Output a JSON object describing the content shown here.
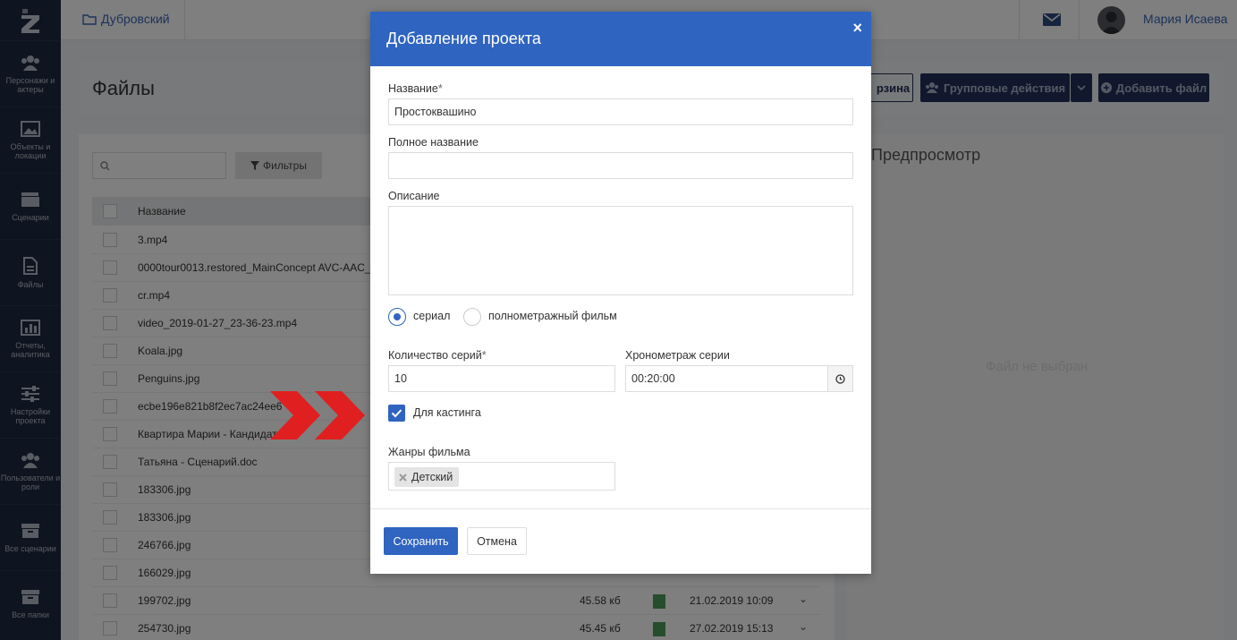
{
  "topbar": {
    "breadcrumb": "Дубровский",
    "user_name": "Мария Исаева"
  },
  "sidebar": {
    "items": [
      {
        "label": "Персонажи и актеры"
      },
      {
        "label": "Объекты и локации"
      },
      {
        "label": "Сценарии"
      },
      {
        "label": "Файлы"
      },
      {
        "label": "Отчеты, аналитика"
      },
      {
        "label": "Настройки проекта"
      },
      {
        "label": "Пользователи и роли"
      },
      {
        "label": "Все сценарии"
      },
      {
        "label": "Все папки"
      }
    ]
  },
  "page": {
    "title": "Файлы",
    "trash_label": "Корзина",
    "trash_visible": "рзина",
    "group_actions_label": "Групповые действия",
    "add_file_label": "Добавить файл",
    "filters_label": "Фильтры",
    "column_name": "Название",
    "preview_title": "Предпросмотр",
    "no_file_label": "Файл не выбран"
  },
  "files": [
    {
      "name": "3.mp4",
      "size": "",
      "date": ""
    },
    {
      "name": "0000tour0013.restored_MainConcept AVC-AAC_",
      "size": "",
      "date": ""
    },
    {
      "name": "cr.mp4",
      "size": "",
      "date": ""
    },
    {
      "name": "video_2019-01-27_23-36-23.mp4",
      "size": "",
      "date": ""
    },
    {
      "name": "Koala.jpg",
      "size": "",
      "date": ""
    },
    {
      "name": "Penguins.jpg",
      "size": "",
      "date": ""
    },
    {
      "name": "ecbe196e821b8f2ec7ac24ee6",
      "size": "",
      "date": ""
    },
    {
      "name": "Квартира Марии - Кандидат",
      "size": "",
      "date": ""
    },
    {
      "name": "Татьяна - Сценарий.doc",
      "size": "",
      "date": ""
    },
    {
      "name": "183306.jpg",
      "size": "",
      "date": ""
    },
    {
      "name": "183306.jpg",
      "size": "",
      "date": ""
    },
    {
      "name": "246766.jpg",
      "size": "",
      "date": ""
    },
    {
      "name": "166029.jpg",
      "size": "",
      "date": ""
    },
    {
      "name": "199702.jpg",
      "size": "45.58 кб",
      "date": "21.02.2019 10:09"
    },
    {
      "name": "254730.jpg",
      "size": "45.45 кб",
      "date": "27.02.2019 15:13"
    }
  ],
  "modal": {
    "title": "Добавление проекта",
    "close_glyph": "×",
    "name_label": "Название",
    "required_mark": "*",
    "name_value": "Простоквашино",
    "full_name_label": "Полное название",
    "full_name_value": "",
    "description_label": "Описание",
    "description_value": "",
    "type_options": [
      "сериал",
      "полнометражный фильм"
    ],
    "type_selected": "сериал",
    "episodes_label": "Количество серий",
    "episodes_value": "10",
    "duration_label": "Хронометраж серии",
    "duration_value": "00:20:00",
    "casting_label": "Для кастинга",
    "casting_checked": true,
    "genres_label": "Жанры фильма",
    "genres": [
      "Детский"
    ],
    "save_label": "Сохранить",
    "cancel_label": "Отмена"
  },
  "colors": {
    "accent": "#2f64c0",
    "sidebar": "#1d2a41",
    "arrow": "#e02020"
  }
}
